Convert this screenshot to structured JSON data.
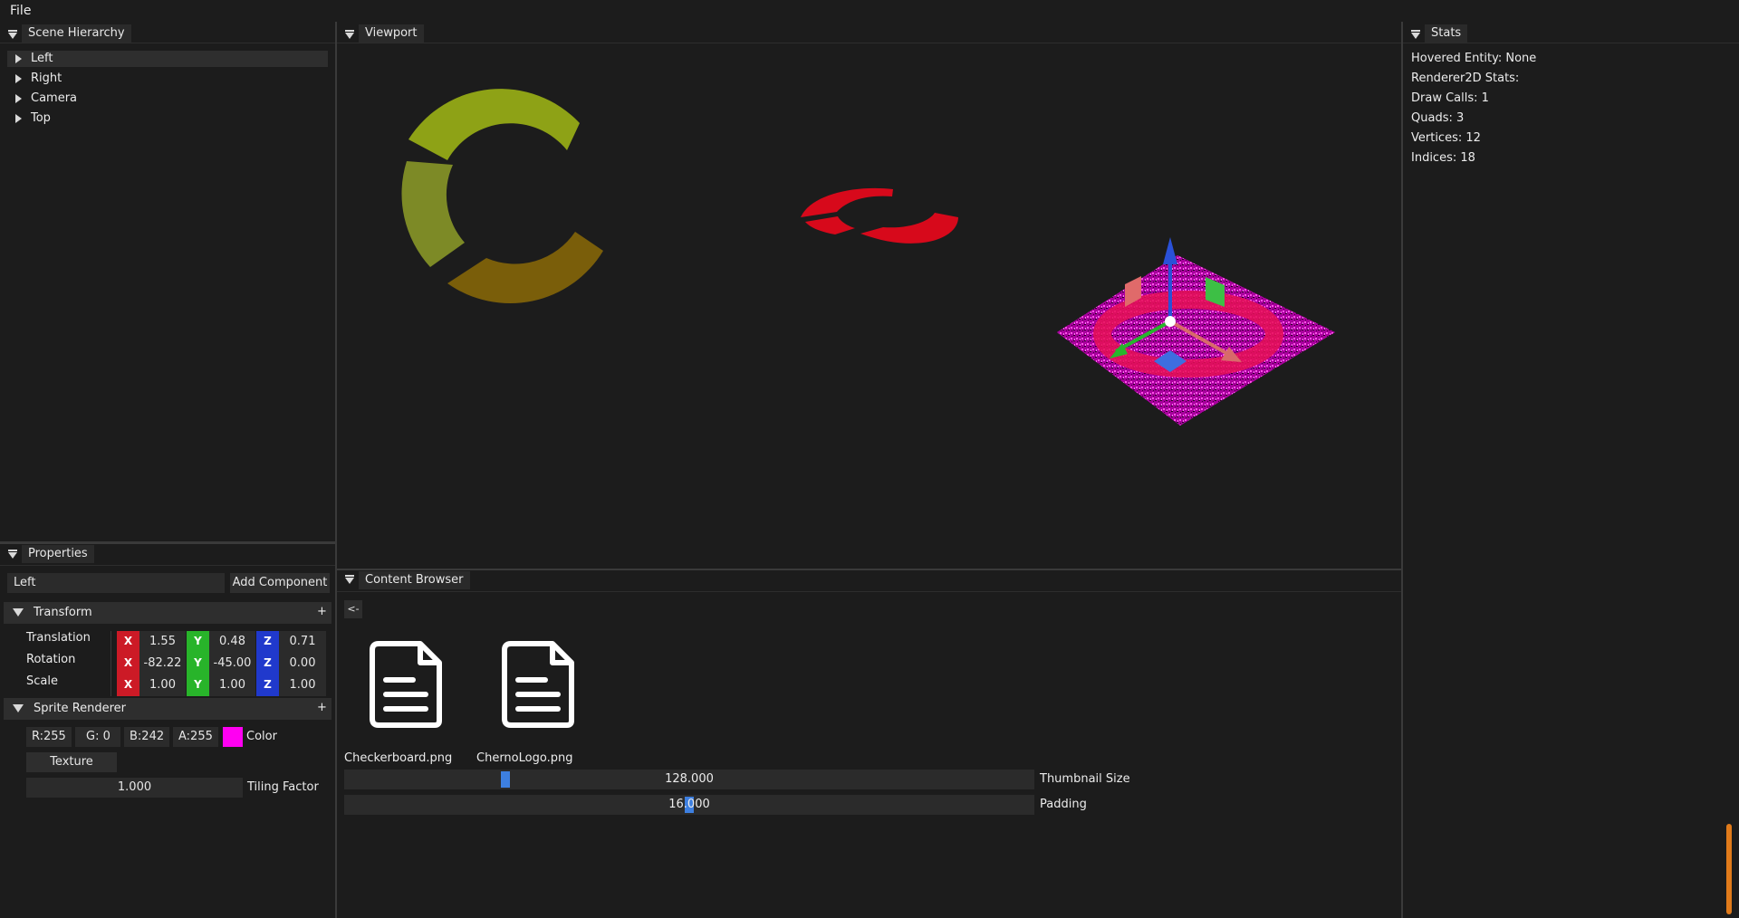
{
  "menu": {
    "file": "File"
  },
  "hierarchy": {
    "title": "Scene Hierarchy",
    "items": [
      "Left",
      "Right",
      "Camera",
      "Top"
    ]
  },
  "properties": {
    "title": "Properties",
    "name_value": "Left",
    "add_component": "Add Component",
    "transform": {
      "title": "Transform",
      "plus": "+",
      "rows": [
        {
          "label": "Translation",
          "x": "1.55",
          "y": "0.48",
          "z": "0.71"
        },
        {
          "label": "Rotation",
          "x": "-82.22",
          "y": "-45.00",
          "z": "0.00"
        },
        {
          "label": "Scale",
          "x": "1.00",
          "y": "1.00",
          "z": "1.00"
        }
      ],
      "axis_x": "X",
      "axis_y": "Y",
      "axis_z": "Z"
    },
    "sprite": {
      "title": "Sprite Renderer",
      "plus": "+",
      "r": "R:255",
      "g": "G:  0",
      "b": "B:242",
      "a": "A:255",
      "color_label": "Color",
      "swatch": "#ff00f2",
      "texture": "Texture",
      "tiling_value": "1.000",
      "tiling_label": "Tiling Factor"
    }
  },
  "viewport": {
    "title": "Viewport"
  },
  "stats": {
    "title": "Stats",
    "lines": [
      "Hovered Entity: None",
      "Renderer2D Stats:",
      "Draw Calls: 1",
      "Quads: 3",
      "Vertices: 12",
      "Indices: 18"
    ]
  },
  "content_browser": {
    "title": "Content Browser",
    "back": "<-",
    "files": [
      "Checkerboard.png",
      "ChernoLogo.png"
    ],
    "thumbnail_value": "128.000",
    "thumbnail_fraction": 0.23,
    "thumbnail_label": "Thumbnail Size",
    "padding_value": "16.000",
    "padding_fraction": 0.5,
    "padding_label": "Padding"
  },
  "colors": {
    "axis_x": "#cc1a26",
    "axis_y": "#28b42a",
    "axis_z": "#2039cc",
    "slider_grab": "#3d7fe0"
  }
}
